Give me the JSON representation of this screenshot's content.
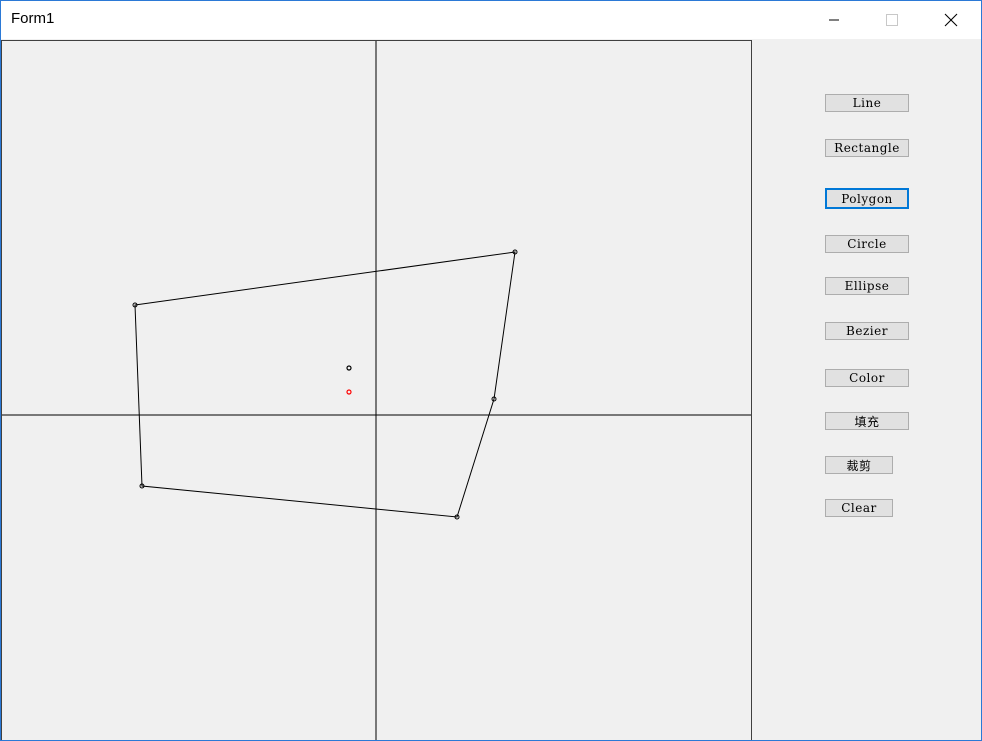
{
  "window": {
    "title": "Form1"
  },
  "toolbar": {
    "buttons": [
      {
        "id": "line",
        "label": "Line"
      },
      {
        "id": "rectangle",
        "label": "Rectangle"
      },
      {
        "id": "polygon",
        "label": "Polygon",
        "active": true
      },
      {
        "id": "circle",
        "label": "Circle"
      },
      {
        "id": "ellipse",
        "label": "Ellipse"
      },
      {
        "id": "bezier",
        "label": "Bezier"
      },
      {
        "id": "color",
        "label": "Color"
      },
      {
        "id": "fill",
        "label": "填充"
      },
      {
        "id": "clip",
        "label": "裁剪"
      },
      {
        "id": "clear",
        "label": "Clear"
      }
    ]
  },
  "colors": {
    "accent": "#0078d7",
    "stroke": "#000000",
    "marker_red": "#ff0000",
    "background": "#f0f0f0"
  }
}
